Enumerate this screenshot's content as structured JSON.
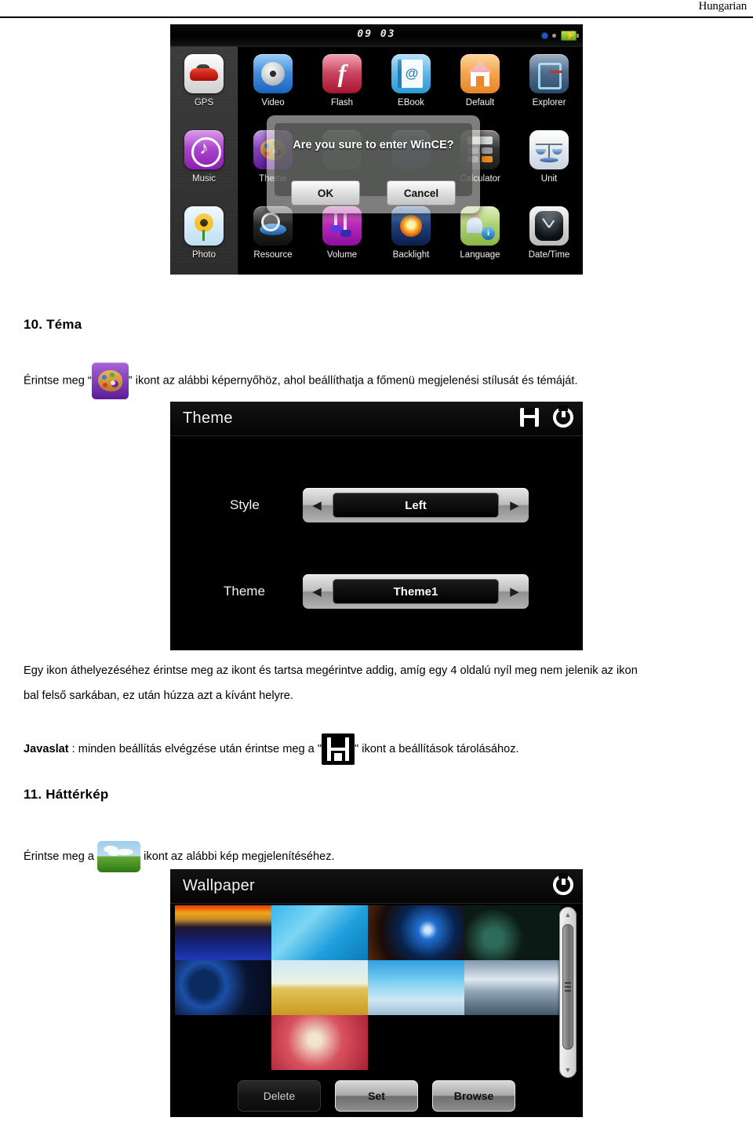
{
  "header": {
    "language_label": "Hungarian"
  },
  "main_menu_screenshot": {
    "statusbar": {
      "clock": "09 03",
      "icons": [
        "indicator-dot-blue",
        "indicator-dot-gray",
        "battery-charging-icon"
      ]
    },
    "sidebar_items": [
      {
        "label": "GPS",
        "icon": "car-icon"
      },
      {
        "label": "Music",
        "icon": "music-note-icon"
      },
      {
        "label": "Photo",
        "icon": "sunflower-icon"
      }
    ],
    "grid_items": [
      {
        "label": "Video",
        "icon": "film-reel-icon"
      },
      {
        "label": "Flash",
        "icon": "flash-f-icon"
      },
      {
        "label": "EBook",
        "icon": "ebook-icon"
      },
      {
        "label": "Default",
        "icon": "home-icon"
      },
      {
        "label": "Explorer",
        "icon": "explorer-icon"
      },
      {
        "label": "Theme",
        "icon": "palette-icon"
      },
      {
        "label": "",
        "icon": "hidden-icon"
      },
      {
        "label": "",
        "icon": "hidden-icon"
      },
      {
        "label": "Calculator",
        "icon": "calculator-icon"
      },
      {
        "label": "Unit",
        "icon": "scales-icon"
      },
      {
        "label": "Resource",
        "icon": "resource-disk-icon"
      },
      {
        "label": "Volume",
        "icon": "volume-icon"
      },
      {
        "label": "Backlight",
        "icon": "backlight-sun-icon"
      },
      {
        "label": "Language",
        "icon": "language-person-icon"
      },
      {
        "label": "Date/Time",
        "icon": "clock-icon"
      }
    ],
    "dialog": {
      "message": "Are you sure to enter WinCE?",
      "ok_label": "OK",
      "cancel_label": "Cancel"
    }
  },
  "section_theme": {
    "heading": "10. Téma",
    "intro_before": "Érintse meg “",
    "intro_after": "” ikont az alábbi képernyőhöz, ahol beállíthatja a főmenü megjelenési stílusát és témáját.",
    "icon": "palette-icon"
  },
  "theme_screenshot": {
    "title": "Theme",
    "bar_icons": [
      "save-floppy-icon",
      "power-icon"
    ],
    "rows": [
      {
        "label": "Style",
        "value": "Left",
        "left_arrow": "◀",
        "right_arrow": "▶"
      },
      {
        "label": "Theme",
        "value": "Theme1",
        "left_arrow": "◀",
        "right_arrow": "▶"
      }
    ]
  },
  "body_paragraphs": {
    "drag_hint_line1": "Egy ikon áthelyezéséhez érintse meg az ikont és tartsa megérintve addig, amíg egy 4 oldalú nyíl meg nem jelenik az ikon",
    "drag_hint_line2": "bal felső sarkában, ez után húzza azt a kívánt helyre.",
    "tip_label": "Javaslat",
    "tip_before": " : minden beállítás elvégzése után érintse meg a \"",
    "tip_after": "\" ikont a beállítások tárolásához.",
    "tip_icon": "save-floppy-icon"
  },
  "section_wallpaper": {
    "heading": "11. Háttérkép",
    "intro_before": "Érintse meg a",
    "intro_after": "ikont az alábbi kép megjelenítéséhez.",
    "icon": "bliss-wallpaper-icon"
  },
  "wallpaper_screenshot": {
    "title": "Wallpaper",
    "bar_icons": [
      "power-icon"
    ],
    "thumbnails": [
      {
        "name": "fiery-horizon"
      },
      {
        "name": "cyan-abstract-swirl"
      },
      {
        "name": "blue-glow-dark"
      },
      {
        "name": "golden-bokeh"
      },
      {
        "name": "blue-planet-space"
      },
      {
        "name": "wheat-field-sun"
      },
      {
        "name": "city-skyline-blue"
      },
      {
        "name": "silver-waves"
      },
      {
        "name": "red-desserts-calendar"
      }
    ],
    "scrollbar": {
      "up_arrow": "▲",
      "down_arrow": "▼"
    },
    "buttons": [
      {
        "label": "Delete",
        "state": "dark"
      },
      {
        "label": "Set",
        "state": "light"
      },
      {
        "label": "Browse",
        "state": "light"
      }
    ]
  }
}
